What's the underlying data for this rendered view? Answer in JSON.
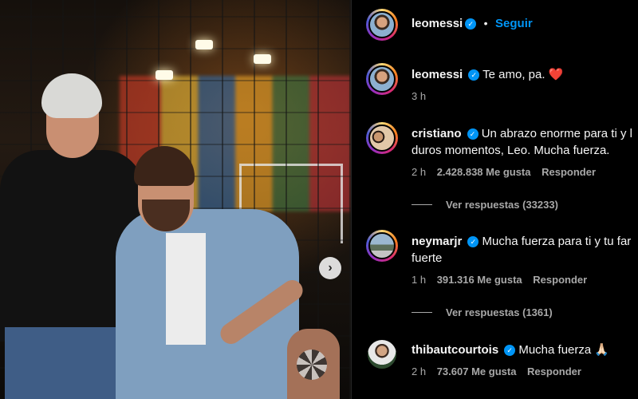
{
  "photo": {
    "carousel_next_icon": "chevron-right-icon"
  },
  "header": {
    "username": "leomessi",
    "separator": "•",
    "follow_label": "Seguir"
  },
  "comments": [
    {
      "username": "leomessi",
      "text": "Te amo, pa.",
      "emoji": "❤️",
      "time": "3 h",
      "likes": "",
      "reply_label": ""
    },
    {
      "username": "cristiano",
      "text_line1": "Un abrazo enorme para ti y l",
      "text_line2": "duros momentos, Leo. Mucha fuerza.",
      "time": "2 h",
      "likes": "2.428.838 Me gusta",
      "reply_label": "Responder",
      "view_replies": "Ver respuestas (33233)"
    },
    {
      "username": "neymarjr",
      "text_line1": "Mucha fuerza para ti y tu far",
      "text_line2": "fuerte",
      "time": "1 h",
      "likes": "391.316 Me gusta",
      "reply_label": "Responder",
      "view_replies": "Ver respuestas (1361)"
    },
    {
      "username": "thibautcourtois",
      "text": "Mucha fuerza",
      "emoji": "🙏🏻",
      "time": "2 h",
      "likes": "73.607 Me gusta",
      "reply_label": "Responder"
    }
  ],
  "colors": {
    "accent": "#0095f6",
    "background": "#000000",
    "secondary_text": "#a8a8a8"
  }
}
